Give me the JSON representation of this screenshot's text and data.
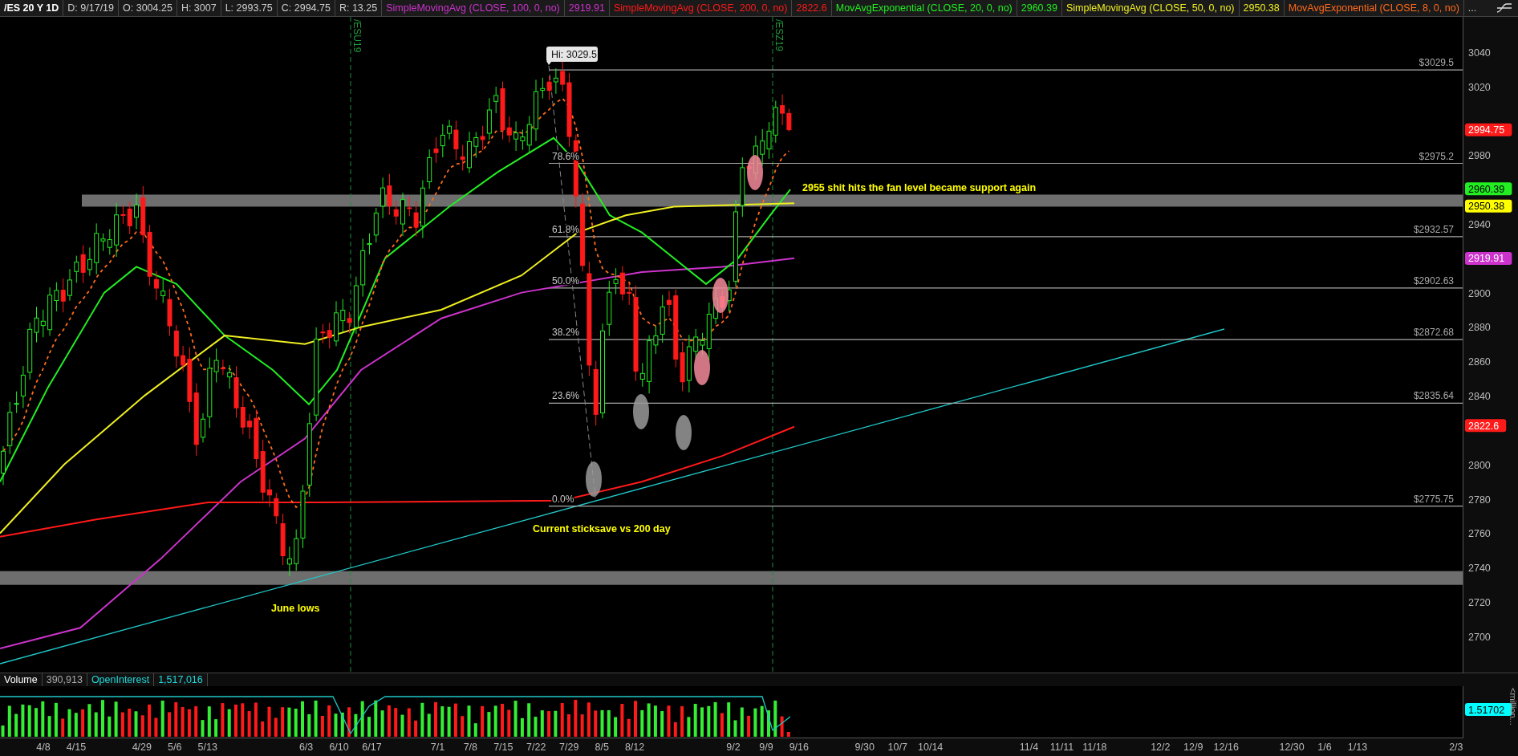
{
  "header": {
    "symbol": "/ES 20 Y 1D",
    "fields": [
      "D: 9/17/19",
      "O: 3004.25",
      "H: 3007",
      "L: 2993.75",
      "C: 2994.75",
      "R: 13.25"
    ],
    "studies": [
      {
        "name": "SimpleMovingAvg (CLOSE, 100, 0, no)",
        "value": "2919.91",
        "color": "#cc33cc"
      },
      {
        "name": "SimpleMovingAvg (CLOSE, 200, 0, no)",
        "value": "2822.6",
        "color": "#ff1a1a"
      },
      {
        "name": "MovAvgExponential (CLOSE, 20, 0, no)",
        "value": "2960.39",
        "color": "#22ee22"
      },
      {
        "name": "SimpleMovingAvg (CLOSE, 50, 0, no)",
        "value": "2950.38",
        "color": "#eeee22"
      },
      {
        "name": "MovAvgExponential (CLOSE, 8, 0, no)",
        "color": "#ff6a1a"
      }
    ],
    "more": "..."
  },
  "price_axis": {
    "ticks": [
      "3040",
      "3020",
      "2980",
      "2940",
      "2900",
      "2880",
      "2860",
      "2840",
      "2800",
      "2780",
      "2760",
      "2740",
      "2720",
      "2700"
    ],
    "tags": [
      {
        "text": "2994.75",
        "color": "#ff1a1a"
      },
      {
        "text": "2960.39",
        "color": "#22ee22"
      },
      {
        "text": "2950.38",
        "color": "#ffff00"
      },
      {
        "text": "2919.91",
        "color": "#cc33cc"
      },
      {
        "text": "2822.6",
        "color": "#ff1a1a"
      }
    ]
  },
  "hi_label": "Hi: 3029.5",
  "fib_levels": [
    {
      "price_label": "$3029.5"
    },
    {
      "ratio": "78.6%",
      "price_label": "$2975.2"
    },
    {
      "ratio": "61.8%",
      "price_label": "$2932.57"
    },
    {
      "ratio": "50.0%",
      "price_label": "$2902.63"
    },
    {
      "ratio": "38.2%",
      "price_label": "$2872.68"
    },
    {
      "ratio": "23.6%",
      "price_label": "$2835.64"
    },
    {
      "ratio": "0.0%",
      "price_label": "$2775.75"
    }
  ],
  "contracts": [
    "/ESU19",
    "/ESZ19"
  ],
  "annotations": [
    "2955 shit hits the fan level became support again",
    "Current sticksave vs 200 day",
    "June lows"
  ],
  "volume": {
    "label": "Volume",
    "value": "390,913",
    "oi_label": "OpenInterest",
    "oi_value": "1,517,016",
    "tag": "1.51702",
    "unit": "<million..."
  },
  "dates": [
    "4/8",
    "4/15",
    "4/29",
    "5/6",
    "5/13",
    "6/3",
    "6/10",
    "6/17",
    "7/1",
    "7/8",
    "7/15",
    "7/22",
    "7/29",
    "8/5",
    "8/12",
    "9/2",
    "9/9",
    "9/16",
    "9/30",
    "10/7",
    "10/14",
    "11/4",
    "11/11",
    "11/18",
    "12/2",
    "12/9",
    "12/16",
    "12/30",
    "1/6",
    "1/13",
    "2/3"
  ]
}
